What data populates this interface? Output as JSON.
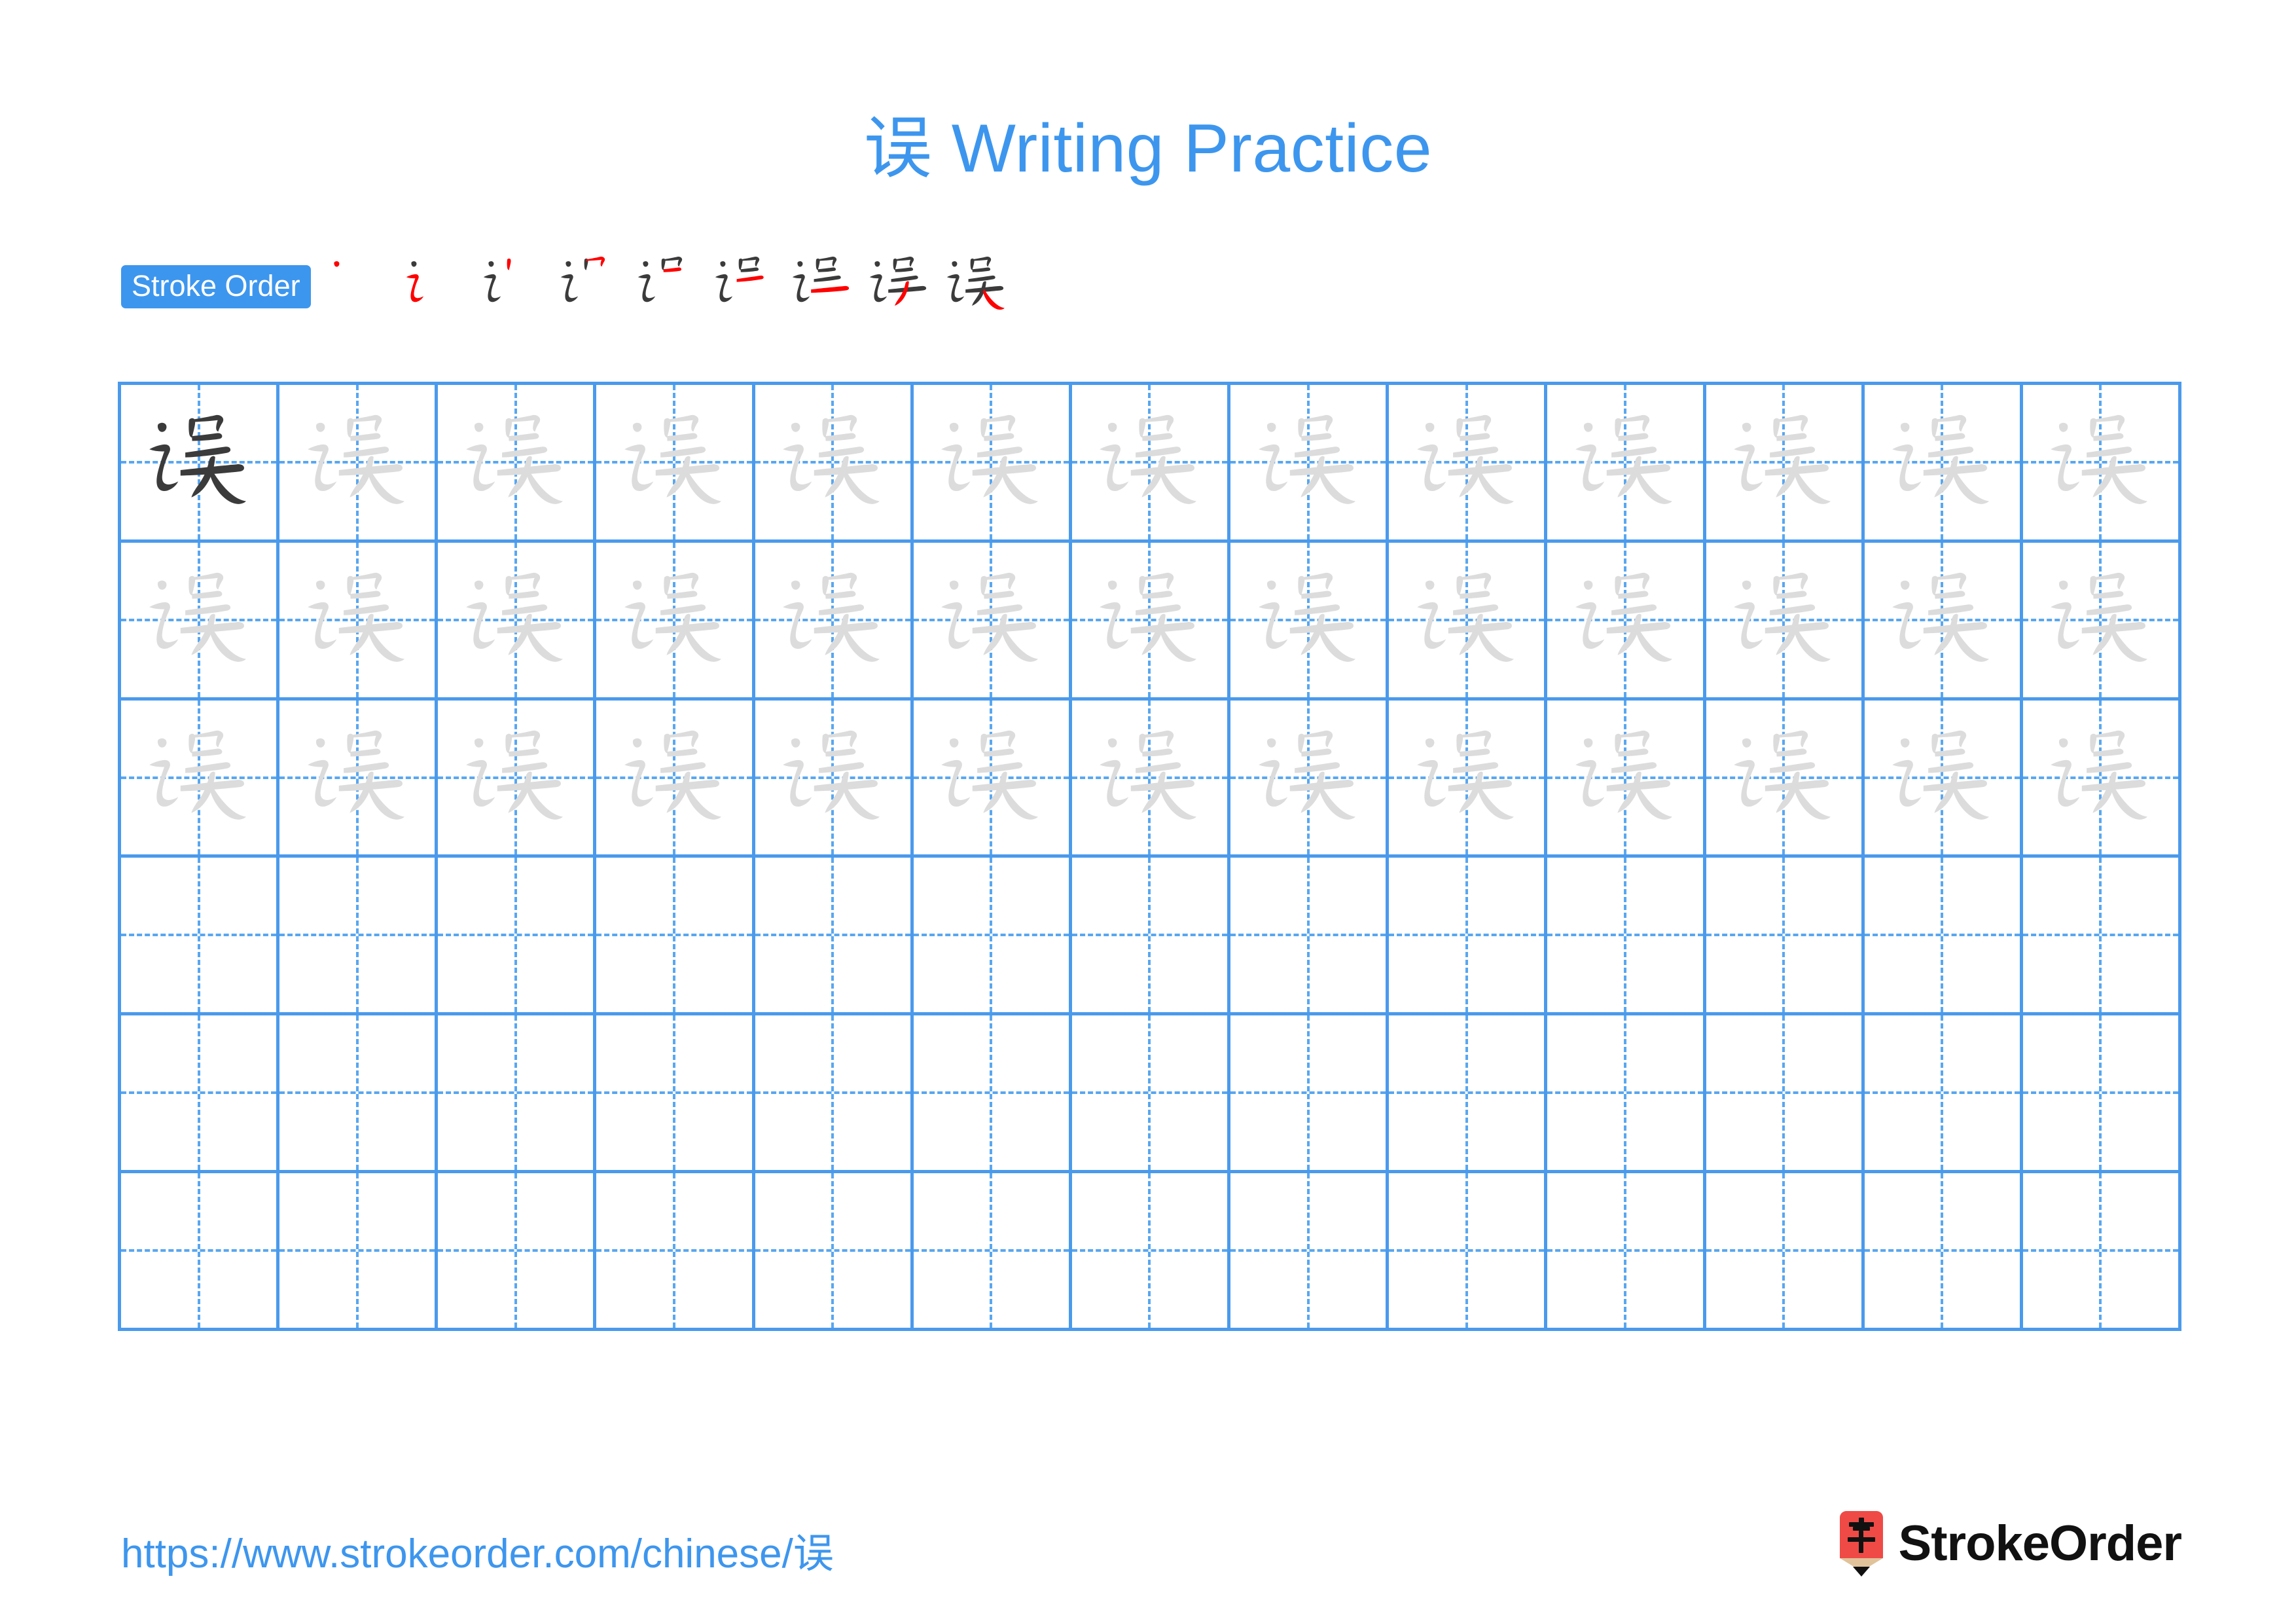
{
  "title": {
    "character": "误",
    "text": "误 Writing Practice",
    "color": "#3d96ee"
  },
  "stroke_order": {
    "badge_label": "Stroke Order",
    "badge_bg": "#3d96ee",
    "badge_text_color": "#ffffff",
    "existing_stroke_color": "#3b3b3b",
    "new_stroke_color": "#ff0000",
    "total_strokes": 9,
    "steps": [
      {
        "index": 1,
        "strokes_shown": 1,
        "new_stroke": 1
      },
      {
        "index": 2,
        "strokes_shown": 2,
        "new_stroke": 2
      },
      {
        "index": 3,
        "strokes_shown": 3,
        "new_stroke": 3
      },
      {
        "index": 4,
        "strokes_shown": 4,
        "new_stroke": 4
      },
      {
        "index": 5,
        "strokes_shown": 5,
        "new_stroke": 5
      },
      {
        "index": 6,
        "strokes_shown": 6,
        "new_stroke": 6
      },
      {
        "index": 7,
        "strokes_shown": 7,
        "new_stroke": 7
      },
      {
        "index": 8,
        "strokes_shown": 8,
        "new_stroke": 8
      },
      {
        "index": 9,
        "strokes_shown": 9,
        "new_stroke": 9
      }
    ]
  },
  "grid": {
    "columns": 13,
    "rows": 6,
    "line_color": "#4a9aec",
    "guide_color": "#59a7f0",
    "model_char_color": "#3b3b3b",
    "trace_char_color": "#dcdcdc",
    "character": "误",
    "row_fill": [
      "model-then-trace",
      "trace",
      "trace",
      "empty",
      "empty",
      "empty"
    ]
  },
  "footer": {
    "url": "https://www.strokeorder.com/chinese/误",
    "url_color": "#3d96ee",
    "brand_name": "StrokeOrder",
    "logo_glyph": "字",
    "logo_body_color": "#ef4a46",
    "logo_wood_color": "#e0c39b",
    "logo_tip_color": "#111111"
  }
}
